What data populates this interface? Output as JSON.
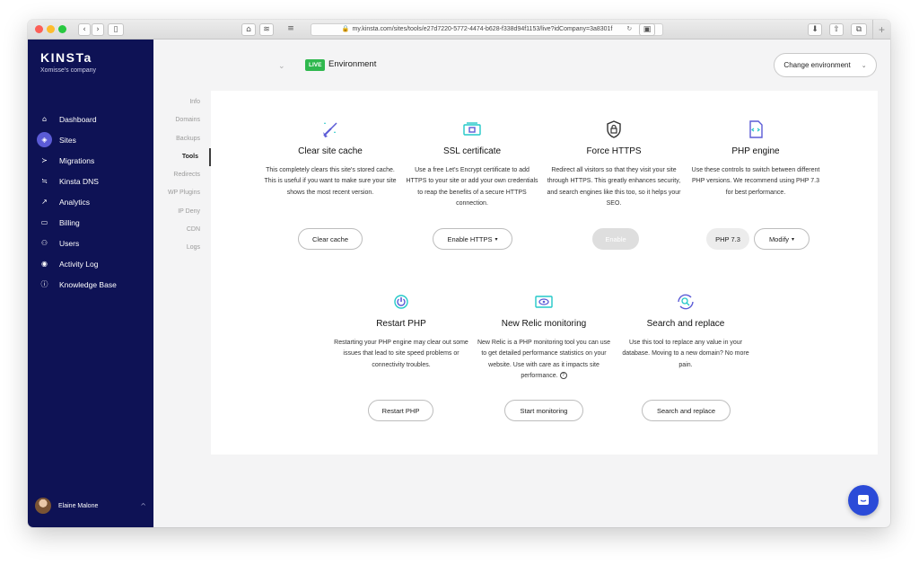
{
  "browser": {
    "url": "my.kinsta.com/sites/tools/e27d7220-5772-4474-b628-f338d94f1153/live?idCompany=3a8301f",
    "new_tab_glyph": "+"
  },
  "sidebar": {
    "logo": "KINSTa",
    "company": "Xomisse's company",
    "items": [
      {
        "label": "Dashboard",
        "icon": "home-icon",
        "glyph": "⌂"
      },
      {
        "label": "Sites",
        "icon": "sites-icon",
        "glyph": "◈"
      },
      {
        "label": "Migrations",
        "icon": "migrations-icon",
        "glyph": "≻"
      },
      {
        "label": "Kinsta DNS",
        "icon": "dns-icon",
        "glyph": "≒"
      },
      {
        "label": "Analytics",
        "icon": "analytics-icon",
        "glyph": "↗"
      },
      {
        "label": "Billing",
        "icon": "billing-icon",
        "glyph": "▭"
      },
      {
        "label": "Users",
        "icon": "users-icon",
        "glyph": "⚇"
      },
      {
        "label": "Activity Log",
        "icon": "activity-log-icon",
        "glyph": "◉"
      },
      {
        "label": "Knowledge Base",
        "icon": "knowledge-base-icon",
        "glyph": "ⓘ"
      }
    ],
    "active_item": "Sites",
    "user": {
      "name": "Elaine Malone"
    }
  },
  "header": {
    "live_badge": "LIVE",
    "environment_label": "Environment",
    "change_environment": "Change environment"
  },
  "subnav": {
    "items": [
      "Info",
      "Domains",
      "Backups",
      "Tools",
      "Redirects",
      "WP Plugins",
      "IP Deny",
      "CDN",
      "Logs"
    ],
    "active": "Tools"
  },
  "tools": {
    "clear_cache": {
      "title": "Clear site cache",
      "description": "This completely clears this site's stored cache. This is useful if you want to make sure your site shows the most recent version.",
      "button": "Clear cache"
    },
    "ssl": {
      "title": "SSL certificate",
      "description": "Use a free Let's Encrypt certificate to add HTTPS to your site or add your own credentials to reap the benefits of a secure HTTPS connection.",
      "button": "Enable HTTPS"
    },
    "force_https": {
      "title": "Force HTTPS",
      "description": "Redirect all visitors so that they visit your site through HTTPS. This greatly enhances security, and search engines like this too, so it helps your SEO.",
      "button": "Enable"
    },
    "php_engine": {
      "title": "PHP engine",
      "description": "Use these controls to switch between different PHP versions. We recommend using PHP 7.3 for best performance.",
      "version": "PHP 7.3",
      "button": "Modify"
    },
    "restart_php": {
      "title": "Restart PHP",
      "description": "Restarting your PHP engine may clear out some issues that lead to site speed problems or connectivity troubles.",
      "button": "Restart PHP"
    },
    "new_relic": {
      "title": "New Relic monitoring",
      "description": "New Relic is a PHP monitoring tool you can use to get detailed performance statistics on your website. Use with care as it impacts site performance.",
      "button": "Start monitoring"
    },
    "search_replace": {
      "title": "Search and replace",
      "description": "Use this tool to replace any value in your database. Moving to a new domain? No more pain.",
      "button": "Search and replace"
    }
  },
  "colors": {
    "sidebar_bg": "#0e1255",
    "accent": "#5b5bd6",
    "live_green": "#2fb84e",
    "chat_blue": "#2b4bd8"
  }
}
